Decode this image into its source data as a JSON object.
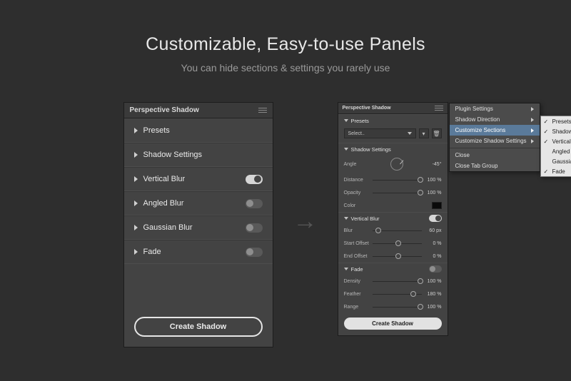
{
  "headline": {
    "title": "Customizable, Easy-to-use Panels",
    "subtitle": "You can hide sections & settings you rarely use"
  },
  "panelA": {
    "title": "Perspective Shadow",
    "rows": [
      {
        "label": "Presets",
        "toggle": null
      },
      {
        "label": "Shadow Settings",
        "toggle": null
      },
      {
        "label": "Vertical Blur",
        "toggle": "on"
      },
      {
        "label": "Angled Blur",
        "toggle": "off"
      },
      {
        "label": "Gaussian Blur",
        "toggle": "off"
      },
      {
        "label": "Fade",
        "toggle": "off"
      }
    ],
    "createLabel": "Create Shadow"
  },
  "panelB": {
    "title": "Perspective Shadow",
    "presets": {
      "label": "Presets",
      "selectLabel": "Select.."
    },
    "shadowSettings": {
      "label": "Shadow Settings",
      "angle": {
        "label": "Angle",
        "value": "-45°"
      },
      "distance": {
        "label": "Distance",
        "value": "100 %",
        "pos": 95
      },
      "opacity": {
        "label": "Opacity",
        "value": "100 %",
        "pos": 95
      },
      "color": {
        "label": "Color"
      }
    },
    "verticalBlur": {
      "label": "Vertical Blur",
      "toggle": "on",
      "blur": {
        "label": "Blur",
        "value": "60 px",
        "pos": 8
      },
      "startOffset": {
        "label": "Start Offset",
        "value": "0 %",
        "pos": 50
      },
      "endOffset": {
        "label": "End Offset",
        "value": "0 %",
        "pos": 50
      }
    },
    "fade": {
      "label": "Fade",
      "toggle": "off",
      "density": {
        "label": "Density",
        "value": "100 %",
        "pos": 95
      },
      "feather": {
        "label": "Feather",
        "value": "180 %",
        "pos": 80
      },
      "range": {
        "label": "Range",
        "value": "100 %",
        "pos": 95
      }
    },
    "createLabel": "Create Shadow"
  },
  "flyout1": {
    "items": [
      {
        "label": "Plugin Settings",
        "sub": true
      },
      {
        "label": "Shadow Direction",
        "sub": true
      },
      {
        "label": "Customize Sections",
        "sub": true,
        "highlight": true
      },
      {
        "label": "Customize Shadow Settings",
        "sub": true
      },
      {
        "sep": true
      },
      {
        "label": "Close"
      },
      {
        "label": "Close Tab Group"
      }
    ]
  },
  "flyout2": {
    "items": [
      {
        "label": "Presets",
        "checked": true
      },
      {
        "label": "Shadow Settings",
        "checked": true
      },
      {
        "label": "Vertical Blur",
        "checked": true
      },
      {
        "label": "Angled Blur",
        "checked": false
      },
      {
        "label": "Gaussian Blur",
        "checked": false
      },
      {
        "label": "Fade",
        "checked": true
      }
    ]
  }
}
